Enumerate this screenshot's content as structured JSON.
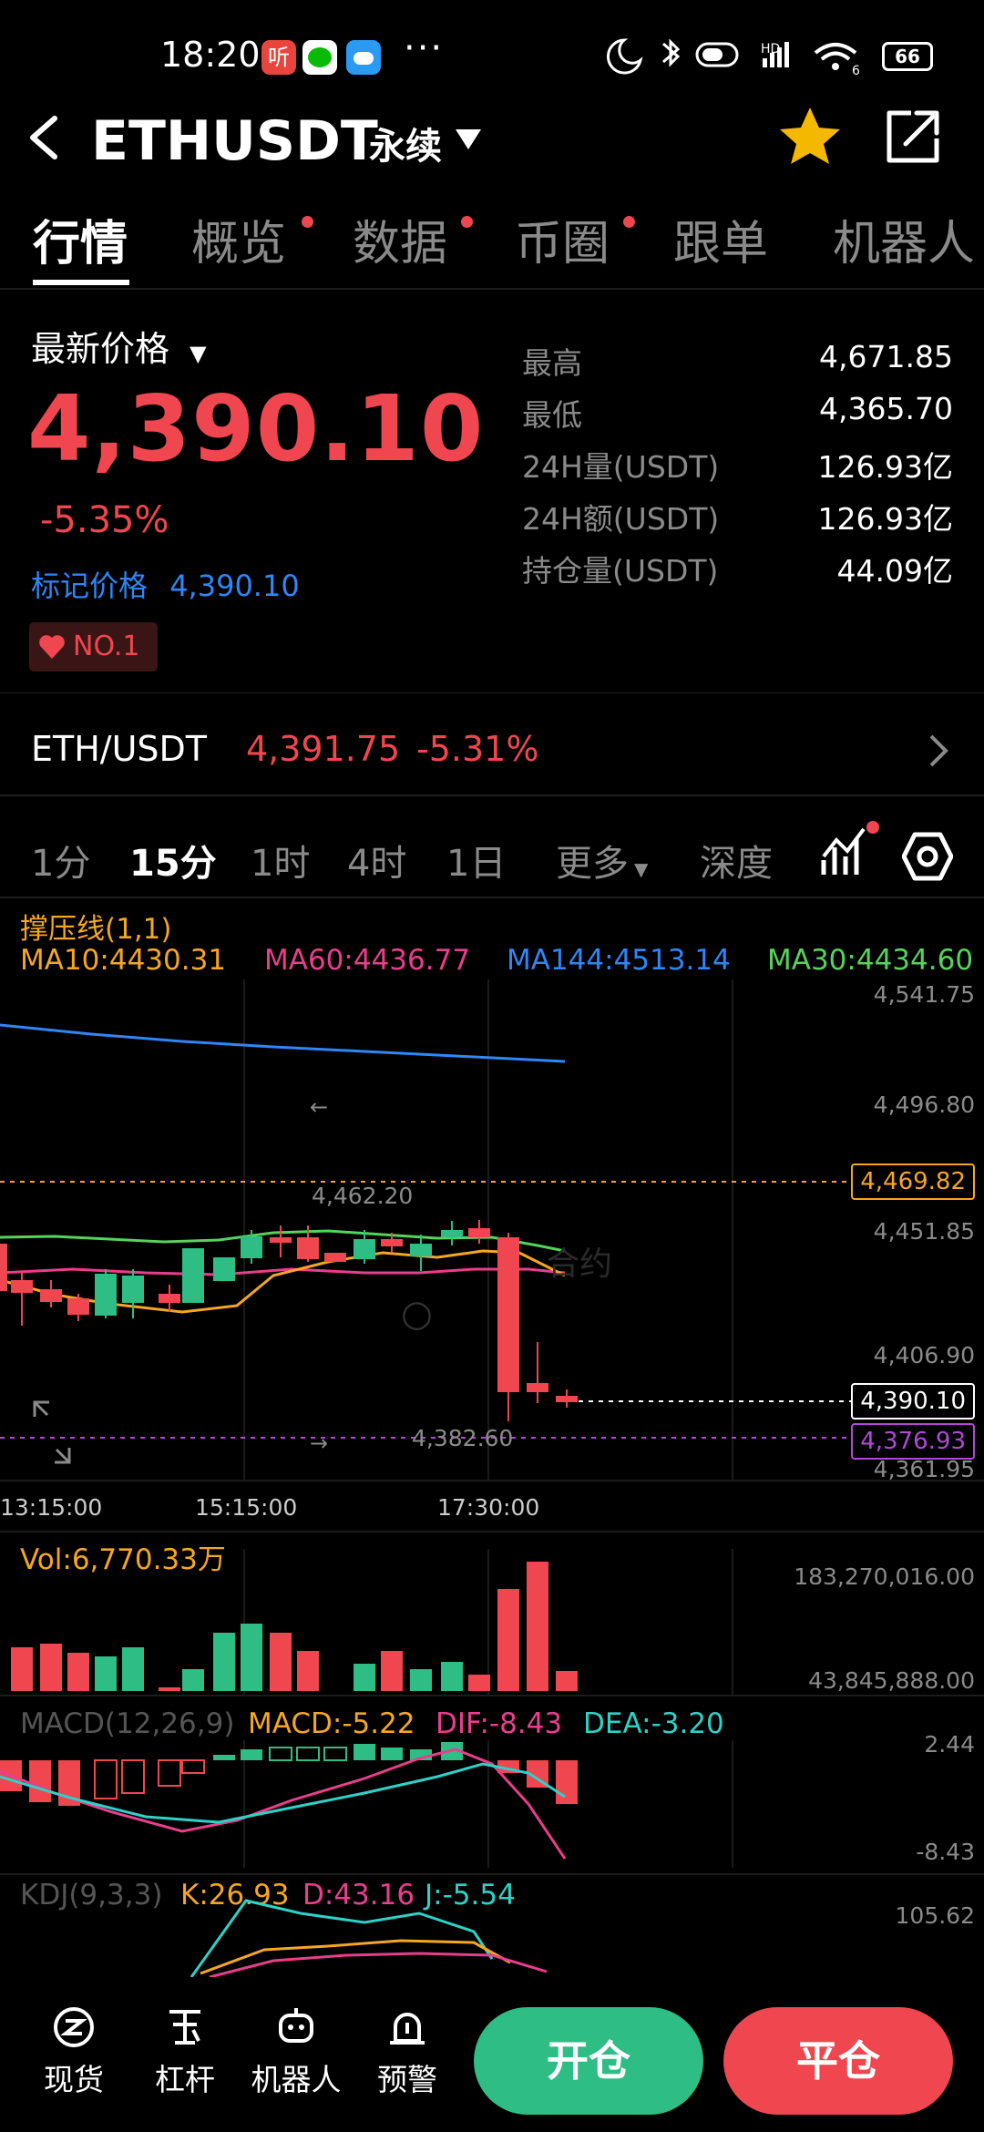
{
  "status_bar": {
    "time": "18:20",
    "dots": "···",
    "battery": "66"
  },
  "header": {
    "title": "ETHUSDT",
    "subtitle": "永续",
    "colors": {
      "star": "#f5b800"
    }
  },
  "tabs": [
    {
      "label": "行情",
      "active": true,
      "dot": false
    },
    {
      "label": "概览",
      "active": false,
      "dot": true
    },
    {
      "label": "数据",
      "active": false,
      "dot": true
    },
    {
      "label": "币圈",
      "active": false,
      "dot": true
    },
    {
      "label": "跟单",
      "active": false,
      "dot": false
    },
    {
      "label": "机器人",
      "active": false,
      "dot": false
    }
  ],
  "price": {
    "label": "最新价格",
    "last": "4,390.10",
    "change_pct": "-5.35%",
    "mark_label": "标记价格",
    "mark_value": "4,390.10",
    "badge": "NO.1"
  },
  "stats": [
    {
      "label": "最高",
      "value": "4,671.85"
    },
    {
      "label": "最低",
      "value": "4,365.70"
    },
    {
      "label": "24H量(USDT)",
      "value": "126.93亿"
    },
    {
      "label": "24H额(USDT)",
      "value": "126.93亿"
    },
    {
      "label": "持仓量(USDT)",
      "value": "44.09亿"
    }
  ],
  "spot": {
    "pair": "ETH/USDT",
    "price": "4,391.75",
    "change": "-5.31%"
  },
  "timeframes": [
    "1分",
    "15分",
    "1时",
    "4时",
    "1日",
    "更多",
    "深度"
  ],
  "active_timeframe": "15分",
  "indicators": {
    "support": "撑压线(1,1)",
    "ma10": "MA10:4430.31",
    "ma60": "MA60:4436.77",
    "ma144": "MA144:4513.14",
    "ma30": "MA30:4434.60"
  },
  "chart_axis": {
    "y_ticks": [
      "4,541.75",
      "4,496.80",
      "4,451.85",
      "4,406.90",
      "4,361.95"
    ],
    "x_ticks": [
      "13:15:00",
      "15:15:00",
      "17:30:00"
    ],
    "high_marker": "4,462.20",
    "low_marker": "4,382.60",
    "resistance_tag": "4,469.82",
    "price_tag": "4,390.10",
    "support_tag": "4,376.93",
    "watermark": "合约"
  },
  "volume": {
    "label": "Vol:6,770.33万",
    "top": "183,270,016.00",
    "bottom": "43,845,888.00"
  },
  "macd": {
    "label": "MACD(12,26,9)",
    "macd": "MACD:-5.22",
    "dif": "DIF:-8.43",
    "dea": "DEA:-3.20",
    "top": "2.44",
    "bottom": "-8.43"
  },
  "kdj": {
    "label": "KDJ(9,3,3)",
    "k": "K:26.93",
    "d": "D:43.16",
    "j": "J:-5.54",
    "top": "105.62"
  },
  "bottom_nav": [
    {
      "label": "现货",
      "icon": "spot-icon"
    },
    {
      "label": "杠杆",
      "icon": "leverage-icon"
    },
    {
      "label": "机器人",
      "icon": "robot-icon"
    },
    {
      "label": "预警",
      "icon": "alert-icon"
    }
  ],
  "actions": {
    "open": "开仓",
    "close": "平仓"
  }
}
